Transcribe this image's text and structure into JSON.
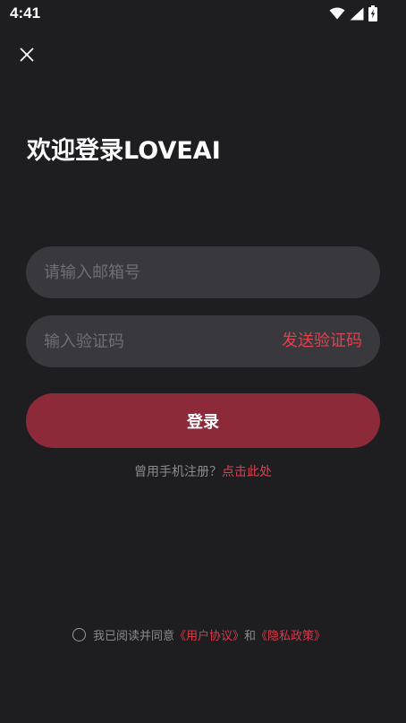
{
  "status_bar": {
    "time": "4:41",
    "icons": [
      "wifi-icon",
      "signal-icon",
      "battery-charging-icon"
    ]
  },
  "header": {
    "close_icon": "close-icon"
  },
  "title": "欢迎登录LOVEAI",
  "email_input": {
    "placeholder": "请输入邮箱号",
    "value": ""
  },
  "code_input": {
    "placeholder": "输入验证码",
    "value": "",
    "send_label": "发送验证码"
  },
  "login_button": {
    "label": "登录"
  },
  "phone_register": {
    "prompt": "曾用手机注册？",
    "link": "点击此处"
  },
  "agreement": {
    "prefix": "我已阅读并同意",
    "user_agreement": "《用户协议》",
    "and": "和",
    "privacy_policy": "《隐私政策》",
    "checked": false
  },
  "colors": {
    "background": "#1e1e20",
    "input_bg": "#39393d",
    "accent": "#e0404e",
    "button_bg": "#8c2a3a"
  }
}
